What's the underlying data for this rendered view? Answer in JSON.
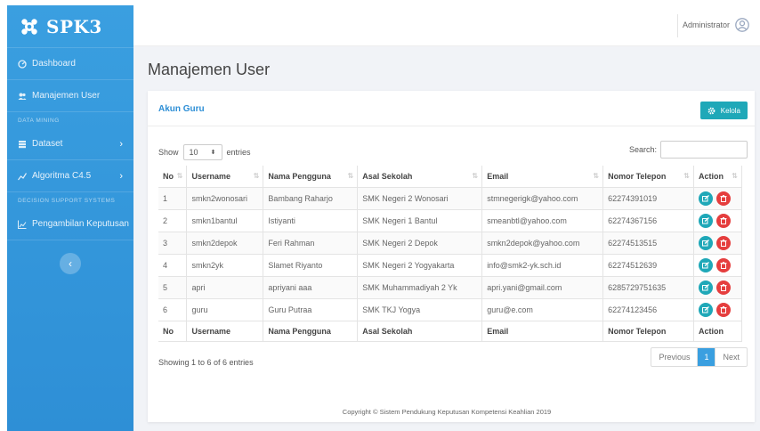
{
  "brand": {
    "name": "SPK3"
  },
  "sidebar": {
    "items": [
      {
        "label": "Dashboard"
      },
      {
        "label": "Manajemen User"
      }
    ],
    "section_data_mining": "DATA MINING",
    "data_items": [
      {
        "label": "Dataset"
      },
      {
        "label": "Algoritma C4.5"
      }
    ],
    "section_dss": "DECISION SUPPORT SYSTEMS",
    "dss_items": [
      {
        "label": "Pengambilan Keputusan"
      }
    ]
  },
  "topbar": {
    "user_label": "Administrator"
  },
  "page": {
    "title": "Manajemen User"
  },
  "card": {
    "title": "Akun Guru",
    "kelola_label": "Kelola"
  },
  "controls": {
    "show_label": "Show",
    "entries_value": "10",
    "entries_label": "entries",
    "search_label": "Search:"
  },
  "table": {
    "headers": [
      "No",
      "Username",
      "Nama Pengguna",
      "Asal Sekolah",
      "Email",
      "Nomor Telepon",
      "Action"
    ],
    "rows": [
      [
        "1",
        "smkn2wonosari",
        "Bambang Raharjo",
        "SMK Negeri 2 Wonosari",
        "stmnegerigk@yahoo.com",
        "62274391019"
      ],
      [
        "2",
        "smkn1bantul",
        "Istiyanti",
        "SMK Negeri 1 Bantul",
        "smeanbtl@yahoo.com",
        "62274367156"
      ],
      [
        "3",
        "smkn2depok",
        "Feri Rahman",
        "SMK Negeri 2 Depok",
        "smkn2depok@yahoo.com",
        "62274513515"
      ],
      [
        "4",
        "smkn2yk",
        "Slamet Riyanto",
        "SMK Negeri 2 Yogyakarta",
        "info@smk2-yk.sch.id",
        "62274512639"
      ],
      [
        "5",
        "apri",
        "apriyani aaa",
        "SMK Muhammadiyah 2 Yk",
        "apri.yani@gmail.com",
        "6285729751635"
      ],
      [
        "6",
        "guru",
        "Guru Putraa",
        "SMK TKJ Yogya",
        "guru@e.com",
        "62274123456"
      ]
    ]
  },
  "pagination": {
    "info": "Showing 1 to 6 of 6 entries",
    "previous": "Previous",
    "current": "1",
    "next": "Next"
  },
  "footer": {
    "text": "Copyright © Sistem Pendukung Keputusan Kompetensi Keahlian 2019"
  },
  "colors": {
    "sidebar": "#3a9fe0",
    "accent_teal": "#1fa8b8",
    "danger": "#e53e3e",
    "link": "#2e8fd6"
  }
}
